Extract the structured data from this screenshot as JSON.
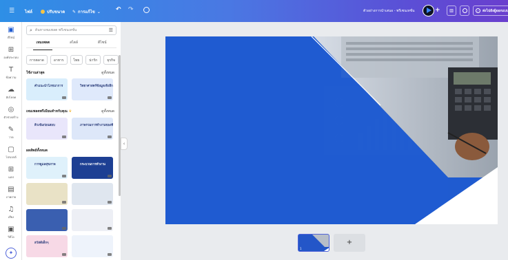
{
  "topbar": {
    "menu_icon": "hamburger-icon",
    "file_label": "ไฟล์",
    "resize_label": "ปรับขนาด",
    "edit_label": "การแก้ไข",
    "undo_icon": "undo-icon",
    "redo_icon": "redo-icon",
    "cloud_icon": "cloud-sync-icon",
    "title": "ตัวอย่างการนำเสนอ - พรีเซนเทชั่น",
    "analytics_icon": "bar-chart-icon",
    "comment_icon": "comment-icon",
    "share_label": "ส่งไปยังผู้ออกแบบ"
  },
  "rail": {
    "items": [
      {
        "icon": "▣",
        "label": "ดีไซน์"
      },
      {
        "icon": "⊞",
        "label": "องค์ประกอบ"
      },
      {
        "icon": "T",
        "label": "ข้อความ"
      },
      {
        "icon": "☁",
        "label": "อัปโหลด"
      },
      {
        "icon": "◎",
        "label": "ตัวช่วยสร้าง"
      },
      {
        "icon": "✎",
        "label": "วาด"
      },
      {
        "icon": "▢",
        "label": "โปรเจกต์"
      },
      {
        "icon": "⊞",
        "label": "แอป"
      },
      {
        "icon": "▤",
        "label": "ภาพถ่าย"
      },
      {
        "icon": "♫",
        "label": "เสียง"
      },
      {
        "icon": "▣",
        "label": "วิดีโอ"
      }
    ]
  },
  "panel": {
    "search_placeholder": "ค้นหาเทมเพลต พรีเซนเทชั่น",
    "tabs": [
      "เทมเพลต",
      "สไตล์",
      "ดีไซน์"
    ],
    "chips": [
      "การตลาด",
      "อาหาร",
      "ไทย",
      "น่ารัก",
      "ธุรกิจ"
    ],
    "sections": [
      {
        "title": "ใช้งานล่าสุด",
        "action": "ดูทั้งหมด"
      },
      {
        "title": "เทมเพลตพรีเมียมสำหรับคุณ",
        "action": "ดูทั้งหมด"
      },
      {
        "title": "ผลลัพธ์ทั้งหมด",
        "action": ""
      }
    ],
    "recent_thumbs": [
      {
        "text": "คำแนะนำโภชนาการ",
        "bg": "#d9eefc"
      },
      {
        "text": "วิทยาศาสตร์ข้อมูลเชิงลึก",
        "bg": "#dfe9fb"
      }
    ],
    "premium_thumbs": [
      {
        "text": "ติวเข้มก่อนสอบ",
        "bg": "#e9e6fb"
      },
      {
        "text": "ภาพรวมการทำงานของทีม",
        "bg": "#dde7f9"
      }
    ],
    "all_thumbs": [
      {
        "text": "การดูแลสุขภาพ",
        "bg": "#dff1fb"
      },
      {
        "text": "กระบวนการทำงาน",
        "bg": "#1d3f93"
      },
      {
        "text": "",
        "bg": "#e9e2c6"
      },
      {
        "text": "",
        "bg": "#dfe6ef"
      },
      {
        "text": "",
        "bg": "#3a5fb0"
      },
      {
        "text": "",
        "bg": "#edeff5"
      },
      {
        "text": "สวัสดีเด็กๆ",
        "bg": "#f7d9e6"
      },
      {
        "text": "",
        "bg": "#eef3fb"
      }
    ]
  },
  "pages": {
    "current_page": "1",
    "add_icon": "+"
  },
  "colors": {
    "accent": "#1f5bd0",
    "topbar_start": "#2e8fe6",
    "topbar_end": "#6a3fce"
  }
}
